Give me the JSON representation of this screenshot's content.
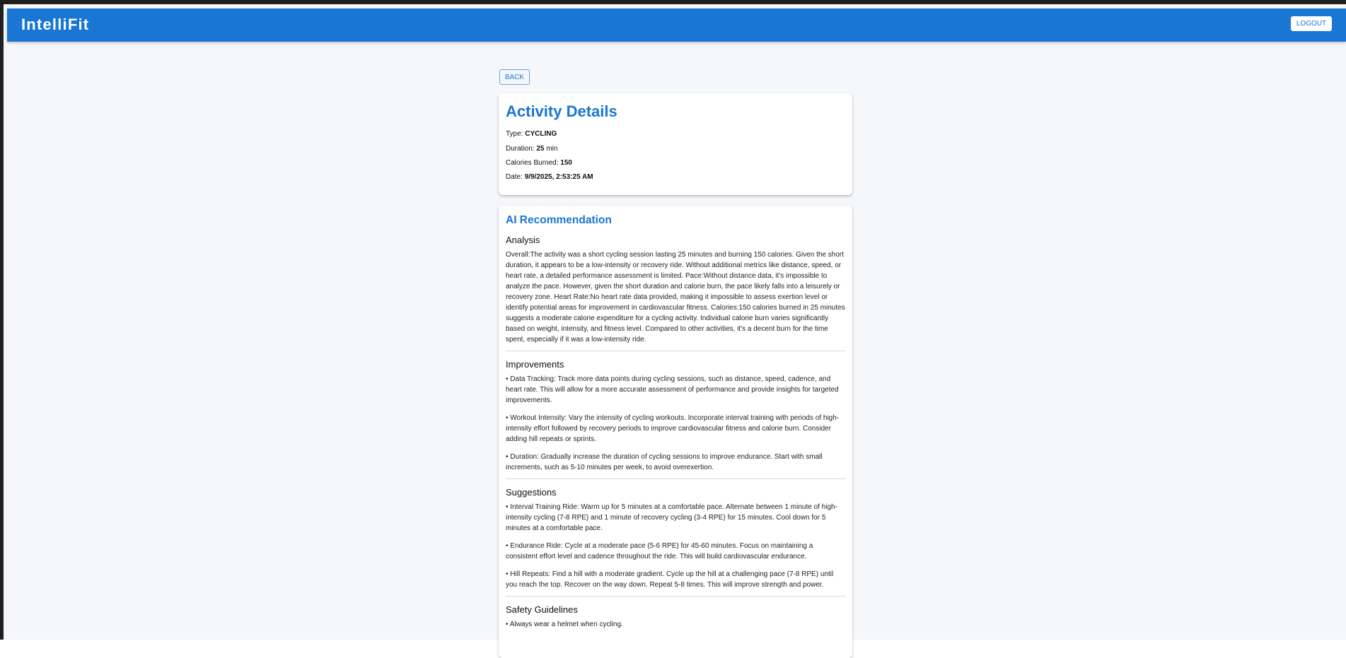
{
  "app": {
    "title": "IntelliFit",
    "logout_label": "LOGOUT"
  },
  "nav": {
    "back_label": "BACK"
  },
  "activity": {
    "heading": "Activity Details",
    "type_label": "Type:",
    "type_value": "CYCLING",
    "duration_label": "Duration:",
    "duration_value": "25",
    "duration_unit": "min",
    "calories_label": "Calories Burned:",
    "calories_value": "150",
    "date_label": "Date:",
    "date_value": "9/9/2025, 2:53:25 AM"
  },
  "recommendation": {
    "heading": "AI Recommendation",
    "analysis": {
      "title": "Analysis",
      "text": "Overall:The activity was a short cycling session lasting 25 minutes and burning 150 calories. Given the short duration, it appears to be a low-intensity or recovery ride. Without additional metrics like distance, speed, or heart rate, a detailed performance assessment is limited. Pace:Without distance data, it's impossible to analyze the pace. However, given the short duration and calorie burn, the pace likely falls into a leisurely or recovery zone. Heart Rate:No heart rate data provided, making it impossible to assess exertion level or identify potential areas for improvement in cardiovascular fitness. Calories:150 calories burned in 25 minutes suggests a moderate calorie expenditure for a cycling activity. Individual calorie burn varies significantly based on weight, intensity, and fitness level. Compared to other activities, it's a decent burn for the time spent, especially if it was a low-intensity ride."
    },
    "improvements": {
      "title": "Improvements",
      "items": [
        "• Data Tracking: Track more data points during cycling sessions, such as distance, speed, cadence, and heart rate. This will allow for a more accurate assessment of performance and provide insights for targeted improvements.",
        "• Workout Intensity: Vary the intensity of cycling workouts. Incorporate interval training with periods of high-intensity effort followed by recovery periods to improve cardiovascular fitness and calorie burn. Consider adding hill repeats or sprints.",
        "• Duration: Gradually increase the duration of cycling sessions to improve endurance. Start with small increments, such as 5-10 minutes per week, to avoid overexertion."
      ]
    },
    "suggestions": {
      "title": "Suggestions",
      "items": [
        "• Interval Training Ride: Warm up for 5 minutes at a comfortable pace. Alternate between 1 minute of high-intensity cycling (7-8 RPE) and 1 minute of recovery cycling (3-4 RPE) for 15 minutes. Cool down for 5 minutes at a comfortable pace.",
        "• Endurance Ride: Cycle at a moderate pace (5-6 RPE) for 45-60 minutes. Focus on maintaining a consistent effort level and cadence throughout the ride. This will build cardiovascular endurance.",
        "• Hill Repeats: Find a hill with a moderate gradient. Cycle up the hill at a challenging pace (7-8 RPE) until you reach the top. Recover on the way down. Repeat 5-8 times. This will improve strength and power."
      ]
    },
    "safety": {
      "title": "Safety Guidelines",
      "items": [
        "• Always wear a helmet when cycling."
      ]
    }
  }
}
